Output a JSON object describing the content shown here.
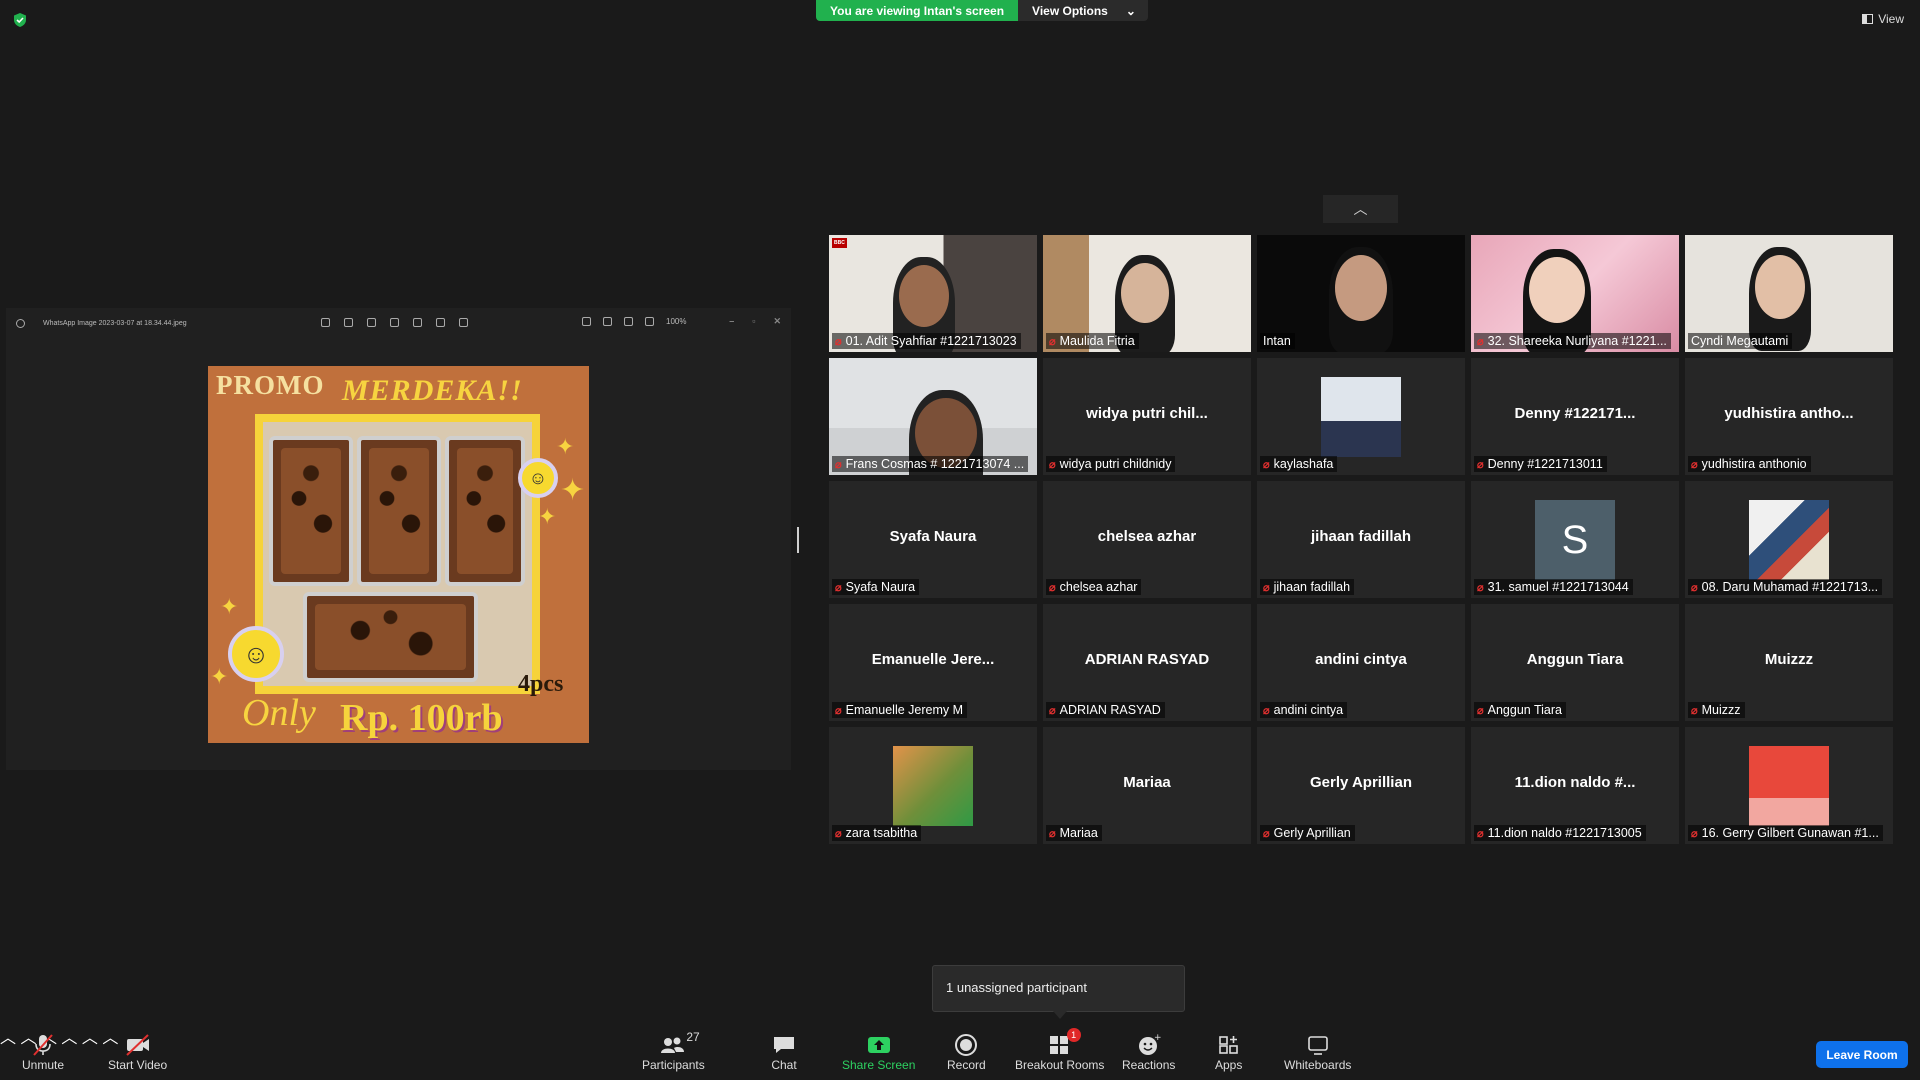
{
  "banner": {
    "viewing_text": "You are viewing Intan's screen",
    "view_options": "View Options"
  },
  "view_button": {
    "label": "View"
  },
  "shared_screen": {
    "file_name": "WhatsApp Image 2023-03-07 at 18.34.44.jpeg",
    "zoom": "100%",
    "promo": {
      "title1": "PROMO",
      "title2": "MERDEKA!!",
      "pcs": "4pcs",
      "only": "Only",
      "price": "Rp. 100rb"
    }
  },
  "participants": [
    {
      "name": "01. Adit Syahfiar #1221713023",
      "type": "video",
      "muted": true
    },
    {
      "name": "Maulida Fitria",
      "type": "video",
      "muted": true
    },
    {
      "name": "Intan",
      "type": "video",
      "muted": false,
      "active_speaker": true
    },
    {
      "name": "32. Shareeka Nurliyana #1221...",
      "type": "video",
      "muted": true
    },
    {
      "name": "Cyndi Megautami",
      "type": "video",
      "muted": false
    },
    {
      "name": "Frans Cosmas # 1221713074 ...",
      "type": "video",
      "muted": true
    },
    {
      "name": "widya putri childnidy",
      "display": "widya putri chil...",
      "type": "name",
      "muted": true
    },
    {
      "name": "kaylashafa",
      "type": "avatar",
      "muted": true
    },
    {
      "name": "Denny #1221713011",
      "display": "Denny #122171...",
      "type": "name",
      "muted": true
    },
    {
      "name": "yudhistira anthonio",
      "display": "yudhistira antho...",
      "type": "name",
      "muted": true
    },
    {
      "name": "Syafa Naura",
      "display": "Syafa Naura",
      "type": "name",
      "muted": true
    },
    {
      "name": "chelsea azhar",
      "display": "chelsea azhar",
      "type": "name",
      "muted": true
    },
    {
      "name": "jihaan fadillah",
      "display": "jihaan fadillah",
      "type": "name",
      "muted": true
    },
    {
      "name": "31. samuel #1221713044",
      "initial": "S",
      "type": "initial",
      "muted": true
    },
    {
      "name": "08. Daru Muhamad #1221713...",
      "type": "avatar",
      "muted": true
    },
    {
      "name": "Emanuelle Jeremy M",
      "display": "Emanuelle Jere...",
      "type": "name",
      "muted": true
    },
    {
      "name": "ADRIAN RASYAD",
      "display": "ADRIAN RASYAD",
      "type": "name",
      "muted": true
    },
    {
      "name": "andini cintya",
      "display": "andini cintya",
      "type": "name",
      "muted": true
    },
    {
      "name": "Anggun Tiara",
      "display": "Anggun Tiara",
      "type": "name",
      "muted": true
    },
    {
      "name": "Muizzz",
      "display": "Muizzz",
      "type": "name",
      "muted": true
    },
    {
      "name": "zara tsabitha",
      "type": "avatar",
      "muted": true
    },
    {
      "name": "Mariaa",
      "display": "Mariaa",
      "type": "name",
      "muted": true
    },
    {
      "name": "Gerly Aprillian",
      "display": "Gerly Aprillian",
      "type": "name",
      "muted": true
    },
    {
      "name": "11.dion naldo #1221713005",
      "display": "11.dion naldo #...",
      "type": "name",
      "muted": true
    },
    {
      "name": "16. Gerry Gilbert Gunawan #1...",
      "type": "avatar",
      "muted": true
    }
  ],
  "tooltip": {
    "text": "1 unassigned participant"
  },
  "toolbar": {
    "unmute": "Unmute",
    "start_video": "Start Video",
    "participants": "Participants",
    "participants_count": "27",
    "chat": "Chat",
    "share_screen": "Share Screen",
    "record": "Record",
    "breakout_rooms": "Breakout Rooms",
    "breakout_badge": "1",
    "reactions": "Reactions",
    "apps": "Apps",
    "whiteboards": "Whiteboards",
    "leave_room": "Leave Room"
  },
  "colors": {
    "accent_green": "#21b14e",
    "leave_blue": "#0e71eb",
    "active_border": "#d6e24a",
    "mute_red": "#e0302f"
  }
}
